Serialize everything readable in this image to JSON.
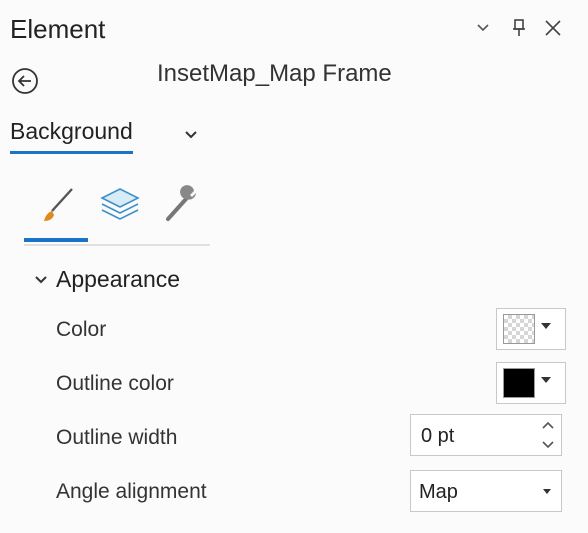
{
  "pane": {
    "title": "Element",
    "header_icons": [
      "menu-chevron-icon",
      "pin-icon",
      "close-icon"
    ],
    "element_name": "InsetMap_Map Frame"
  },
  "dropdown": {
    "label": "Background"
  },
  "tabs": [
    {
      "icon": "brush-icon",
      "active": true
    },
    {
      "icon": "layers-icon",
      "active": false
    },
    {
      "icon": "wrench-icon",
      "active": false
    }
  ],
  "section": {
    "title": "Appearance",
    "expanded": true
  },
  "properties": {
    "color": {
      "label": "Color",
      "value": "transparent"
    },
    "outline_color": {
      "label": "Outline color",
      "value": "#000000"
    },
    "outline_width": {
      "label": "Outline width",
      "value": "0 pt"
    },
    "angle_alignment": {
      "label": "Angle alignment",
      "value": "Map"
    }
  },
  "colors": {
    "accent": "#1a73c9"
  }
}
